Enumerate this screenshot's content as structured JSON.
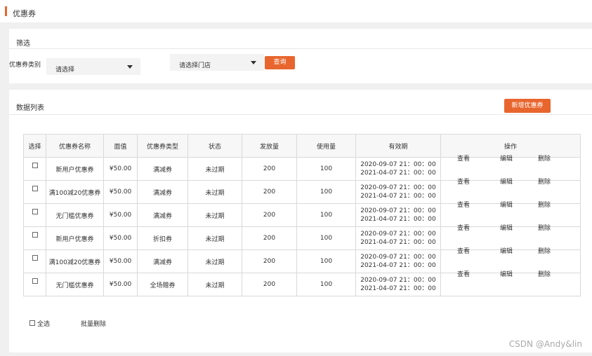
{
  "header": {
    "title": "优惠券"
  },
  "filter": {
    "title": "筛选",
    "type_label": "优惠券类别",
    "type_select": "请选择",
    "store_select": "请选择门店",
    "query_button": "查询"
  },
  "list": {
    "title": "数据列表",
    "add_button": "新增优惠券",
    "columns": [
      "选择",
      "优惠券名称",
      "面值",
      "优惠券类型",
      "状态",
      "发放量",
      "使用量",
      "有效期",
      "操作"
    ],
    "rows": [
      {
        "name": "新用户优惠券",
        "value": "¥50.00",
        "type": "满减券",
        "status": "未过期",
        "issued": "200",
        "used": "100",
        "start": "2020-09-07 21：00：00",
        "end": "2021-04-07 21：00：00"
      },
      {
        "name": "满100减20优惠券",
        "value": "¥50.00",
        "type": "满减券",
        "status": "未过期",
        "issued": "200",
        "used": "100",
        "start": "2020-09-07 21：00：00",
        "end": "2021-04-07 21：00：00"
      },
      {
        "name": "无门槛优惠券",
        "value": "¥50.00",
        "type": "满减券",
        "status": "未过期",
        "issued": "200",
        "used": "100",
        "start": "2020-09-07 21：00：00",
        "end": "2021-04-07 21：00：00"
      },
      {
        "name": "新用户优惠券",
        "value": "¥50.00",
        "type": "折扣券",
        "status": "未过期",
        "issued": "200",
        "used": "100",
        "start": "2020-09-07 21：00：00",
        "end": "2021-04-07 21：00：00"
      },
      {
        "name": "满100减20优惠券",
        "value": "¥50.00",
        "type": "满减券",
        "status": "未过期",
        "issued": "200",
        "used": "100",
        "start": "2020-09-07 21：00：00",
        "end": "2021-04-07 21：00：00"
      },
      {
        "name": "无门槛优惠券",
        "value": "¥50.00",
        "type": "全场赠券",
        "status": "未过期",
        "issued": "200",
        "used": "100",
        "start": "2020-09-07 21：00：00",
        "end": "2021-04-07 21：00：00"
      }
    ],
    "ops": {
      "view": "查看",
      "edit": "编辑",
      "delete": "删除"
    },
    "select_all": "全选",
    "batch_delete": "批量删除"
  },
  "watermark": "CSDN @Andy&lin",
  "colors": {
    "accent": "#e8662e"
  }
}
